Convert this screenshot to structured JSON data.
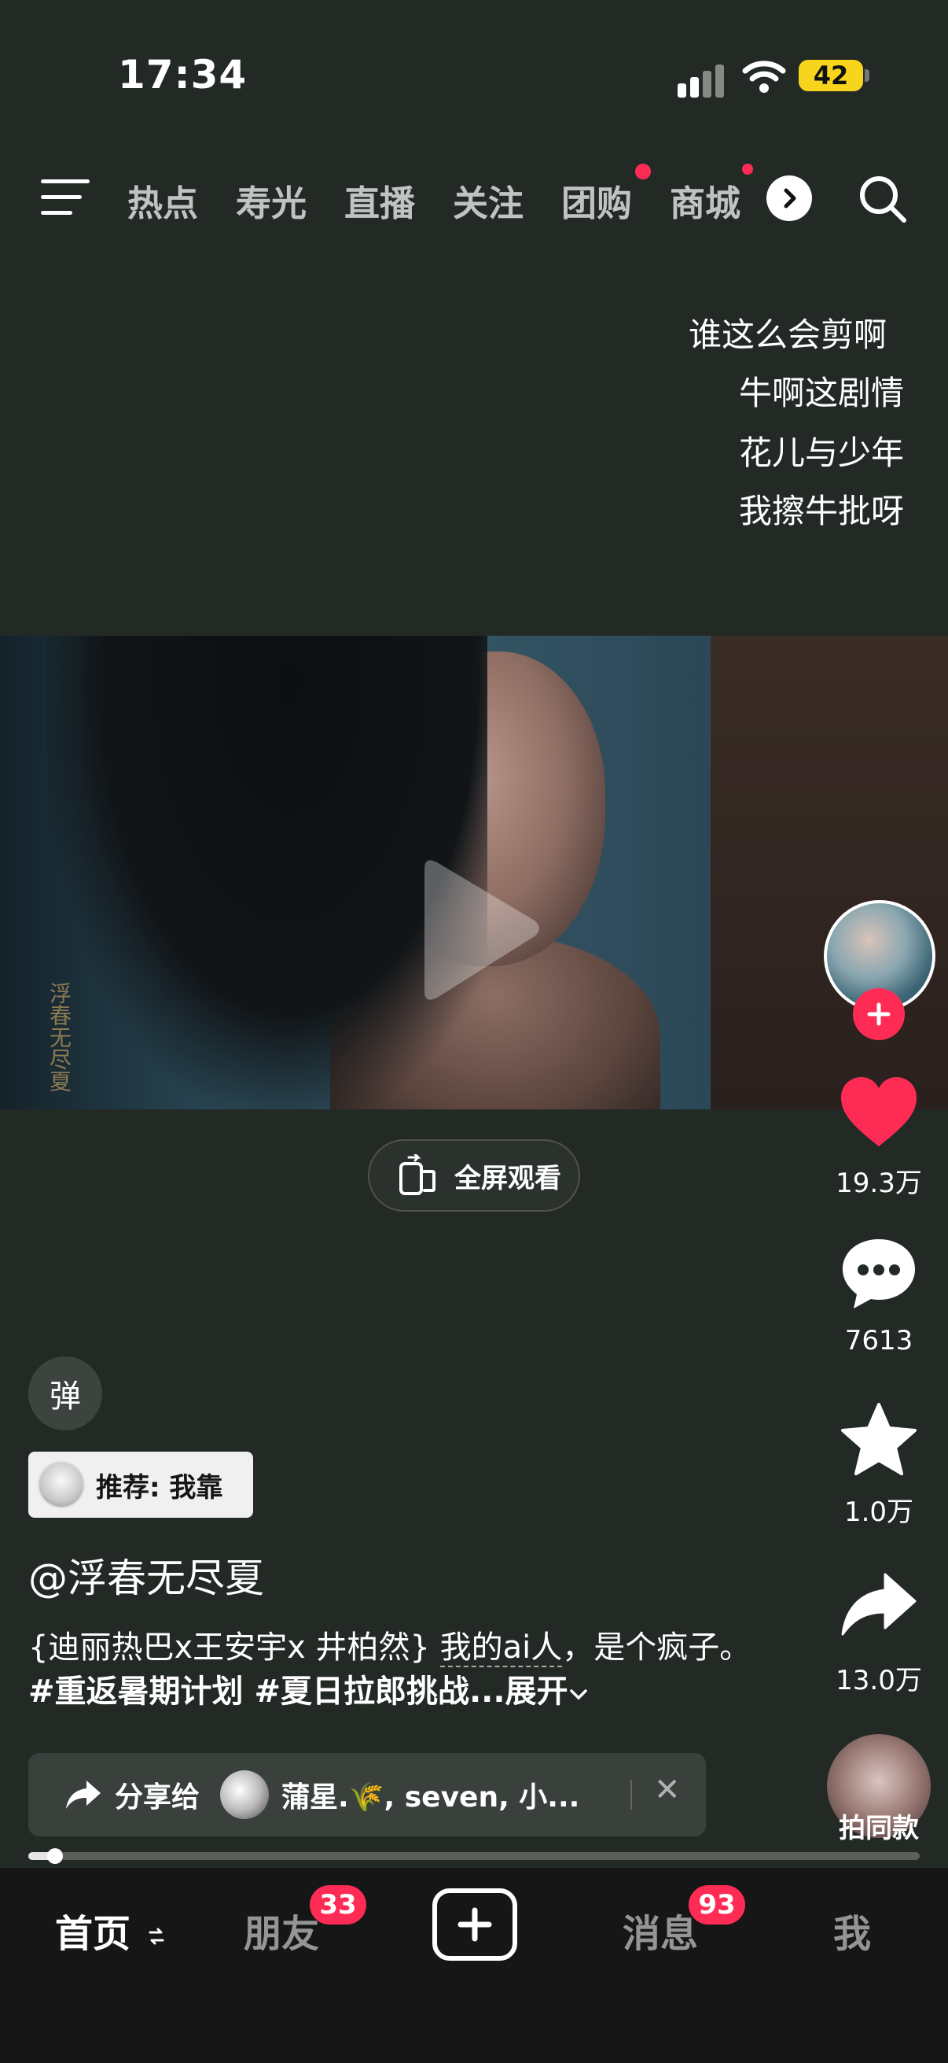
{
  "status_bar": {
    "time": "17:34",
    "battery": "42",
    "icons": [
      "signal-icon",
      "wifi-icon",
      "battery-icon"
    ]
  },
  "top_nav": {
    "tabs": [
      {
        "label": "热点",
        "dot": false
      },
      {
        "label": "寿光",
        "dot": false
      },
      {
        "label": "直播",
        "dot": false
      },
      {
        "label": "关注",
        "dot": false
      },
      {
        "label": "团购",
        "dot": true
      },
      {
        "label": "商城",
        "dot": true
      }
    ],
    "icons": [
      "menu-icon",
      "chevron-right-icon",
      "search-icon"
    ]
  },
  "danmaku": [
    "谁这么会剪啊",
    "牛啊这剧情",
    "花儿与少年",
    "我擦牛批呀"
  ],
  "video": {
    "watermark": "浮春无尽夏",
    "fullscreen_label": "全屏观看"
  },
  "actions": {
    "likes": "19.3万",
    "comments": "7613",
    "favorites": "1.0万",
    "shares": "13.0万",
    "same_style": "拍同款"
  },
  "info": {
    "danmaku_toggle": "弹",
    "recommend": "推荐: 我靠",
    "author": "@浮春无尽夏",
    "caption_part1": "{迪丽热巴x王安宇x 井柏然} ",
    "caption_link": "我的ai人",
    "caption_part2": "，是个疯子。 ",
    "caption_tags": "#重返暑期计划 #夏日拉郎挑战...",
    "caption_more": "展开"
  },
  "share_bar": {
    "label": "分享给",
    "recipients": "蒲星.🌾, seven, 小...",
    "close": "✕"
  },
  "progress": {
    "fraction": 0.03
  },
  "bottom_nav": {
    "home": "首页",
    "friends": "朋友",
    "friends_badge": "33",
    "messages": "消息",
    "messages_badge": "93",
    "me": "我"
  },
  "colors": {
    "accent": "#fe2c55",
    "background": "#232a25",
    "battery": "#f7d51d"
  }
}
